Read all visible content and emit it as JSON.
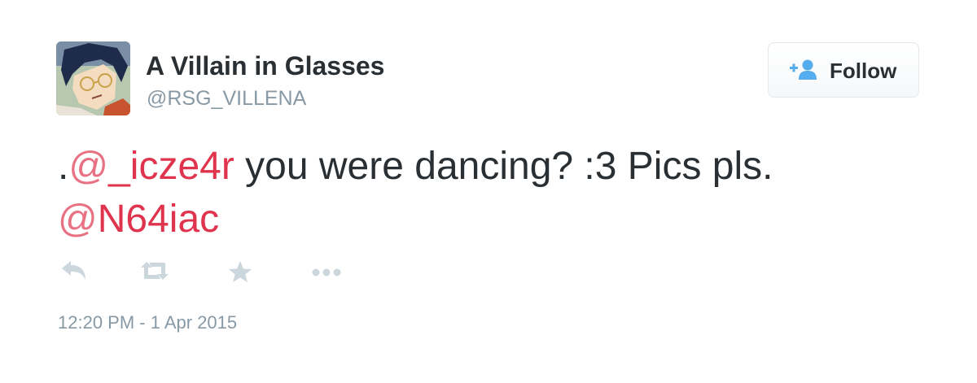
{
  "user": {
    "display_name": "A Villain in Glasses",
    "handle": "@RSG_VILLENA",
    "avatar_icon": "avatar-illustration"
  },
  "follow_button": {
    "label": "Follow",
    "icon": "add-user-icon",
    "icon_color": "#55acee"
  },
  "tweet": {
    "prefix": ".",
    "mention1_at": "@",
    "mention1_name": "_icze4r",
    "body": " you were dancing? :3 Pics pls.",
    "mention2_at": "@",
    "mention2_name": "N64iac",
    "mention_color": "#e0334e"
  },
  "actions": {
    "reply_icon": "reply-icon",
    "retweet_icon": "retweet-icon",
    "favorite_icon": "star-icon",
    "more_icon": "more-icon",
    "icon_color": "#ccd6dd"
  },
  "timestamp": "12:20 PM - 1 Apr 2015"
}
